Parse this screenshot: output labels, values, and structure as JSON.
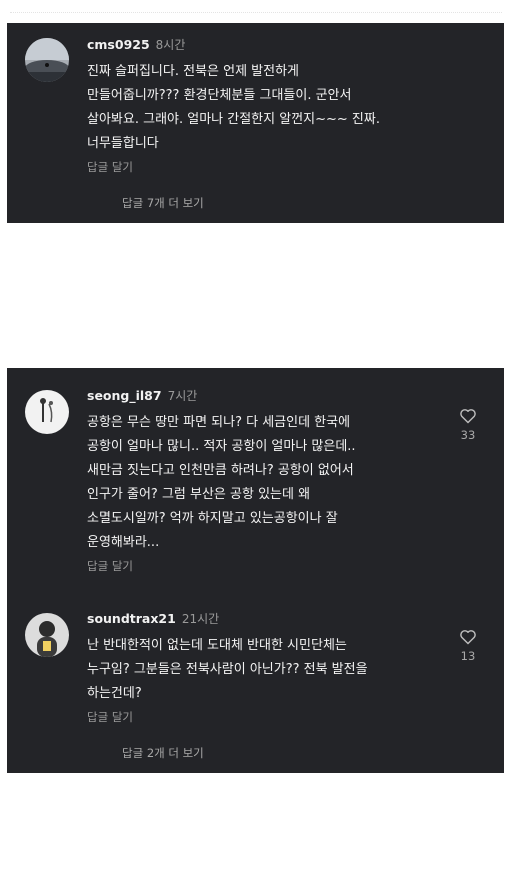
{
  "comments": [
    {
      "username": "cms0925",
      "time": "8시간",
      "text": "진짜 슬퍼집니다. 전북은 언제 발전하게\n만들어줍니까??? 환경단체분들 그대들이. 군안서\n살아봐요.  그래야. 얼마나 간절한지 알껀지~~~ 진짜.\n너무들합니다",
      "reply_label": "답글 달기"
    },
    {
      "username": "seong_il87",
      "time": "7시간",
      "text": "공항은 무슨 땅만 파면 되나? 다 세금인데 한국에\n공항이 얼마나 많니.. 적자 공항이 얼마나 많은데..\n새만금 짓는다고 인천만큼 하려나? 공항이 없어서\n인구가 줄어?  그럼 부산은 공항 있는데 왜\n소멸도시일까?  억까 하지말고 있는공항이나 잘\n운영해봐라...",
      "reply_label": "답글 달기",
      "likes": "33",
      "like_icon": "heart-outline-icon"
    },
    {
      "username": "soundtrax21",
      "time": "21시간",
      "text": "난 반대한적이 없는데 도대체 반대한 시민단체는\n누구임? 그분들은 전북사람이 아닌가?? 전북 발전을\n하는건데?",
      "reply_label": "답글 달기",
      "likes": "13",
      "like_icon": "heart-outline-icon"
    }
  ],
  "view_more_1": "답글 7개 더 보기",
  "view_more_2": "답글 2개 더 보기",
  "colors": {
    "panel_bg": "#232428",
    "text": "#f4f4f4",
    "muted": "#9a9a9a",
    "page_bg": "#ffffff"
  }
}
